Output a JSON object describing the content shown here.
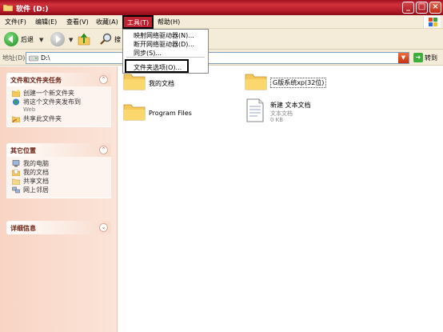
{
  "window": {
    "title": "软件 (D:)",
    "controls": [
      "_",
      "□",
      "×"
    ]
  },
  "menubar": {
    "items": [
      "文件(F)",
      "编辑(E)",
      "查看(V)",
      "收藏(A)",
      "工具(T)",
      "帮助(H)"
    ],
    "active_index": 4
  },
  "toolbar": {
    "back_label": "后退",
    "search_label": "搜"
  },
  "address": {
    "label": "地址(D)",
    "value": "D:\\",
    "go_label": "转到"
  },
  "tools_menu": {
    "items": [
      "映射网络驱动器(N)...",
      "断开网络驱动器(D)...",
      "同步(S)...",
      "文件夹选项(O)..."
    ],
    "highlighted_index": 3
  },
  "left_panels": [
    {
      "title": "文件和文件夹任务",
      "rows": [
        {
          "label": "创建一个新文件夹",
          "icon": "new-folder-icon"
        },
        {
          "label": "将这个文件夹发布到",
          "sub": "Web",
          "icon": "web-publish-icon"
        },
        {
          "label": "共享此文件夹",
          "icon": "share-folder-icon"
        }
      ]
    },
    {
      "title": "其它位置",
      "rows": [
        {
          "label": "我的电脑",
          "icon": "my-computer-icon"
        },
        {
          "label": "我的文档",
          "icon": "my-documents-icon"
        },
        {
          "label": "共享文档",
          "icon": "shared-documents-icon"
        },
        {
          "label": "网上邻居",
          "icon": "network-places-icon"
        }
      ]
    },
    {
      "title": "详细信息",
      "rows": []
    }
  ],
  "files": [
    {
      "name": "我的文档",
      "type": "folder"
    },
    {
      "name": "G版系统xp(32位)",
      "type": "folder"
    },
    {
      "name": "Program Files",
      "type": "folder"
    },
    {
      "name": "新建 文本文档",
      "type": "text",
      "kind": "文本文档",
      "size": "0 KB"
    }
  ],
  "colors": {
    "titlebar": "#b81c28",
    "menu_highlight": "#c02030",
    "panel_bg": "#f8d4c4",
    "folder": "#f5c85a"
  }
}
